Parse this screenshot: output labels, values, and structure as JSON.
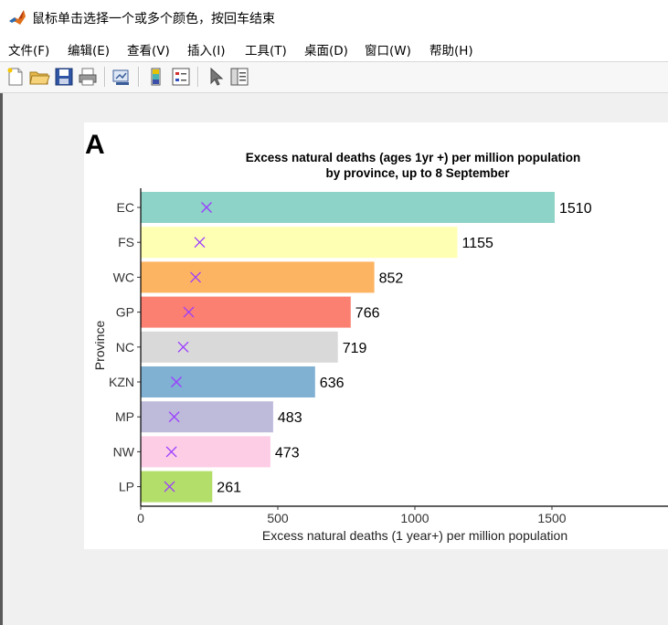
{
  "window": {
    "title": "鼠标单击选择一个或多个颜色，按回车结束"
  },
  "menu": [
    {
      "label": "文件(F)"
    },
    {
      "label": "编辑(E)"
    },
    {
      "label": "查看(V)"
    },
    {
      "label": "插入(I)"
    },
    {
      "label": "工具(T)"
    },
    {
      "label": "桌面(D)"
    },
    {
      "label": "窗口(W)"
    },
    {
      "label": "帮助(H)"
    }
  ],
  "toolbar": {
    "icons": [
      "new-file-icon",
      "open-folder-icon",
      "save-icon",
      "print-icon",
      "link-plot-icon",
      "colorbar-icon",
      "legend-icon",
      "pointer-icon",
      "property-editor-icon"
    ]
  },
  "colors": {
    "marker": "#9b3cff",
    "bars": [
      "#8dd3c7",
      "#ffffb3",
      "#fdb462",
      "#fb8072",
      "#d9d9d9",
      "#80b1d3",
      "#bebada",
      "#fccde5",
      "#b3de69"
    ]
  },
  "chart_data": {
    "type": "bar",
    "orientation": "horizontal",
    "panel_label": "A",
    "title": "Excess natural deaths (ages 1yr +) per million population",
    "subtitle": "by province, up to 8 September",
    "xlabel": "Excess natural deaths (1 year+) per million population",
    "ylabel": "Province",
    "categories": [
      "EC",
      "FS",
      "WC",
      "GP",
      "NC",
      "KZN",
      "MP",
      "NW",
      "LP"
    ],
    "values": [
      1510,
      1155,
      852,
      766,
      719,
      636,
      483,
      473,
      261
    ],
    "value_labels": [
      "1510",
      "1155",
      "852",
      "766",
      "719",
      "636",
      "483",
      "473",
      "261"
    ],
    "markers": [
      240,
      215,
      200,
      175,
      155,
      130,
      122,
      112,
      105
    ],
    "xticks": [
      0,
      500,
      1000,
      1500
    ],
    "xtick_labels": [
      "0",
      "500",
      "1000",
      "1500"
    ],
    "xlim": [
      0,
      1900
    ],
    "grid": false,
    "legend": "none"
  }
}
